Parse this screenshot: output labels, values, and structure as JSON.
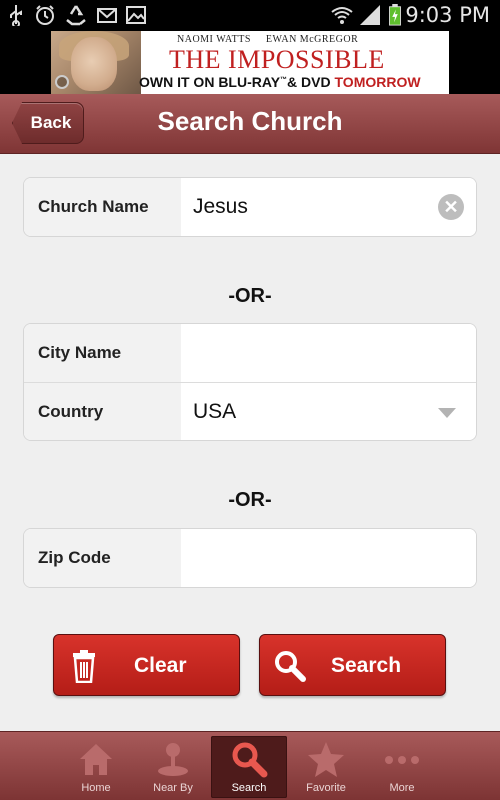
{
  "status_bar": {
    "time": "9:03 PM",
    "icons": [
      "usb-icon",
      "alarm-icon",
      "recycle-icon",
      "mail-icon",
      "image-icon",
      "wifi-icon",
      "signal-icon",
      "battery-charging-icon"
    ]
  },
  "ad": {
    "names": "NAOMI WATTS     EWAN McGREGOR",
    "title": "THE IMPOSSIBLE",
    "cta_prefix": "OWN IT ON BLU-RAY",
    "cta_tm": "™",
    "cta_mid": "& DVD ",
    "cta_highlight": "TOMORROW"
  },
  "header": {
    "back_label": "Back",
    "title": "Search Church"
  },
  "form": {
    "church_name": {
      "label": "Church Name",
      "value": "Jesus"
    },
    "or_1": "-OR-",
    "city_name": {
      "label": "City Name",
      "value": ""
    },
    "country": {
      "label": "Country",
      "value": "USA"
    },
    "or_2": "-OR-",
    "zip_code": {
      "label": "Zip Code",
      "value": ""
    }
  },
  "actions": {
    "clear_label": "Clear",
    "search_label": "Search"
  },
  "tabs": [
    {
      "label": "Home",
      "icon": "house-icon",
      "active": false
    },
    {
      "label": "Near By",
      "icon": "map-pin-icon",
      "active": false
    },
    {
      "label": "Search",
      "icon": "magnifier-icon",
      "active": true
    },
    {
      "label": "Favorite",
      "icon": "star-icon",
      "active": false
    },
    {
      "label": "More",
      "icon": "more-dots-icon",
      "active": false
    }
  ],
  "colors": {
    "header": "#8f4545",
    "button_red": "#c92820",
    "tab_active": "#4e1b1b"
  }
}
